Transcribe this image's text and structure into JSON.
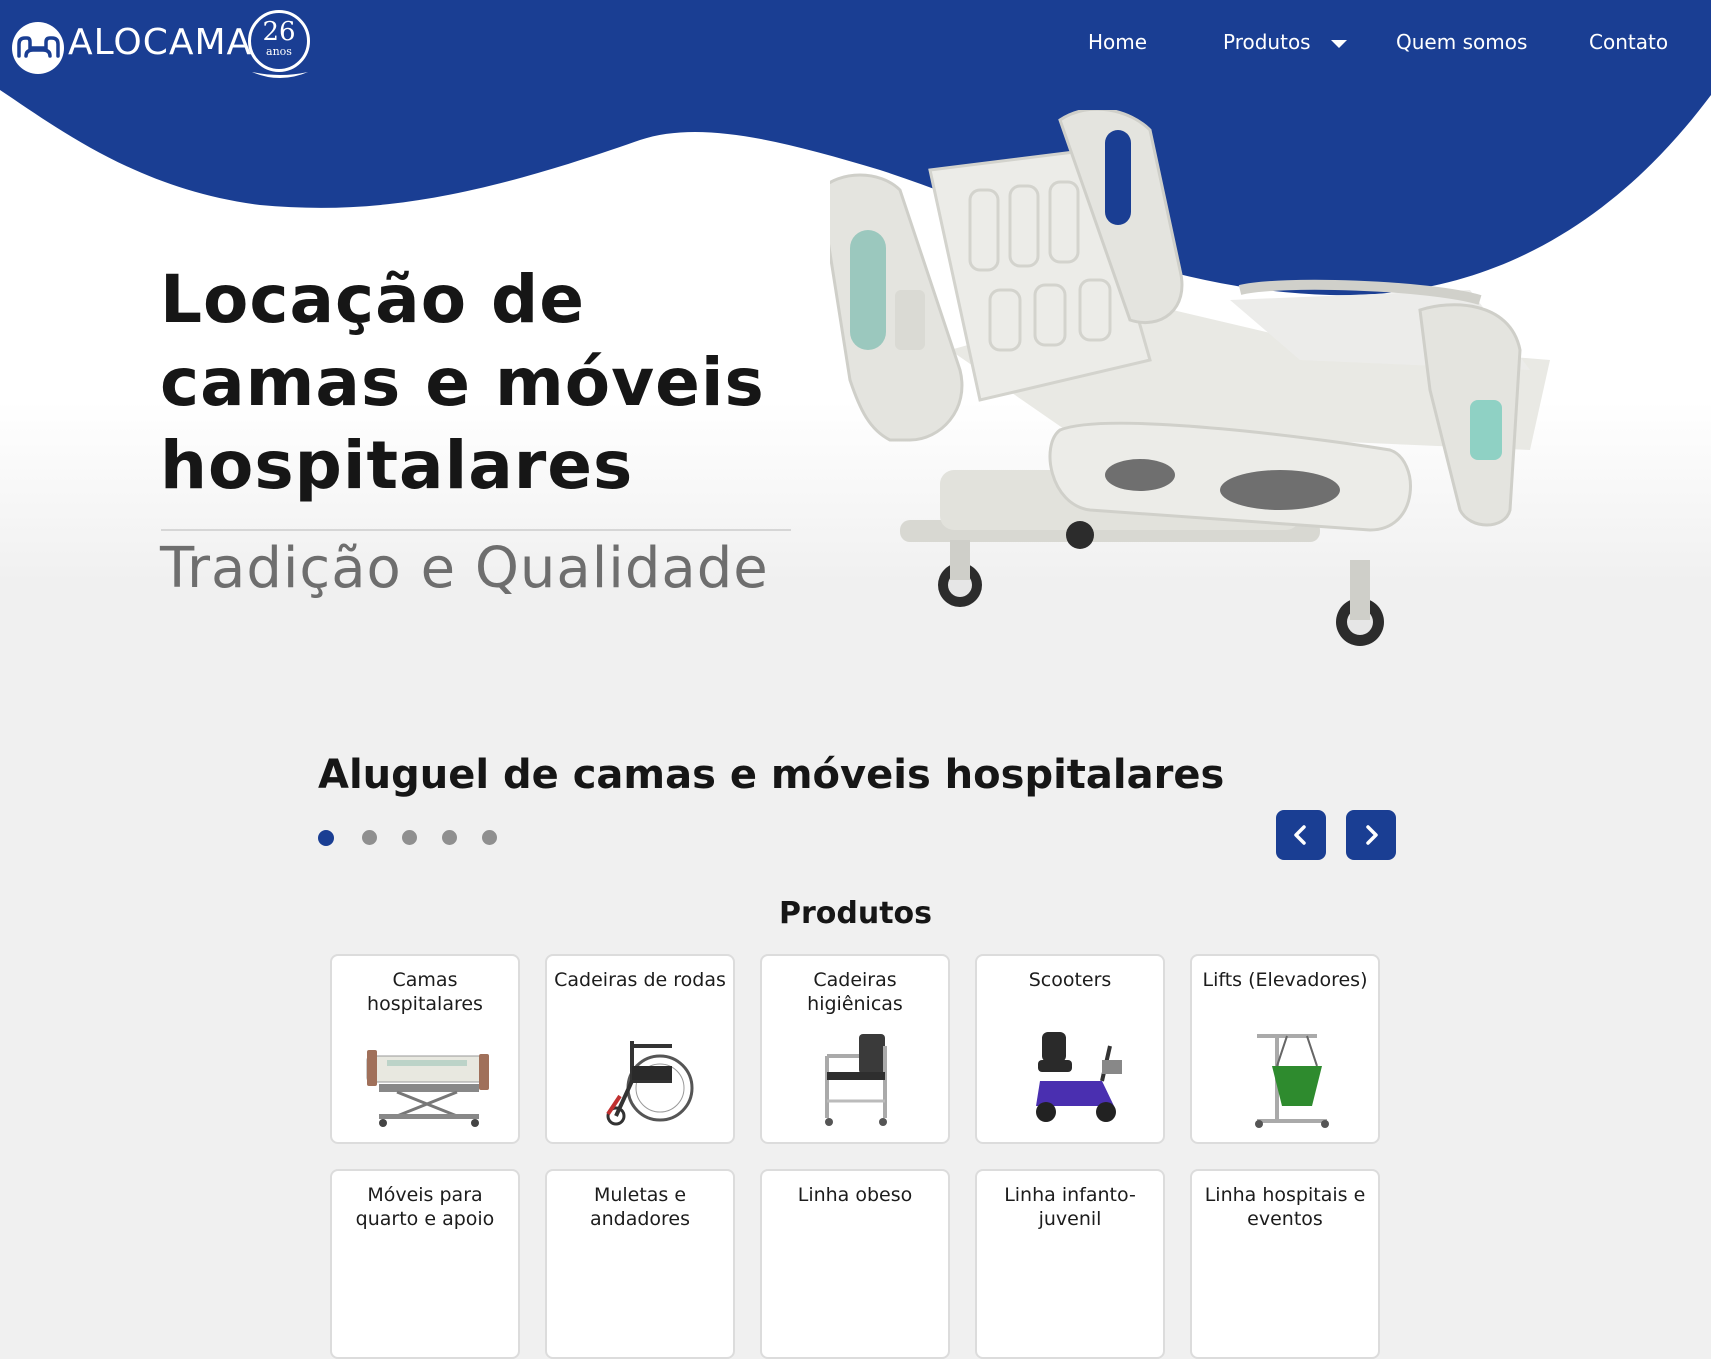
{
  "header": {
    "brand": "ALOCAMA",
    "badge_number": "26",
    "badge_text": "anos",
    "nav": {
      "home": "Home",
      "produtos": "Produtos",
      "quem_somos": "Quem somos",
      "contato": "Contato"
    }
  },
  "hero": {
    "title_line1": "Locação de",
    "title_line2": "camas e móveis",
    "title_line3": "hospitalares",
    "subtitle": "Tradição e Qualidade"
  },
  "carousel": {
    "heading": "Aluguel de camas e móveis hospitalares",
    "dot_count": 5,
    "active_dot": 1
  },
  "products": {
    "heading": "Produtos",
    "items": [
      {
        "label": "Camas hospitalares",
        "icon": "hospital-bed-icon"
      },
      {
        "label": "Cadeiras de rodas",
        "icon": "wheelchair-icon"
      },
      {
        "label": "Cadeiras higiênicas",
        "icon": "commode-chair-icon"
      },
      {
        "label": "Scooters",
        "icon": "mobility-scooter-icon"
      },
      {
        "label": "Lifts (Elevadores)",
        "icon": "patient-lift-icon"
      },
      {
        "label": "Móveis para quarto e apoio",
        "icon": ""
      },
      {
        "label": "Muletas e andadores",
        "icon": ""
      },
      {
        "label": "Linha obeso",
        "icon": ""
      },
      {
        "label": "Linha infanto-juvenil",
        "icon": ""
      },
      {
        "label": "Linha hospitais e eventos",
        "icon": ""
      }
    ]
  },
  "colors": {
    "brand_blue": "#1a3e93",
    "background": "#f0f0f0",
    "text_dark": "#161616",
    "text_muted": "#6e6e6e"
  }
}
